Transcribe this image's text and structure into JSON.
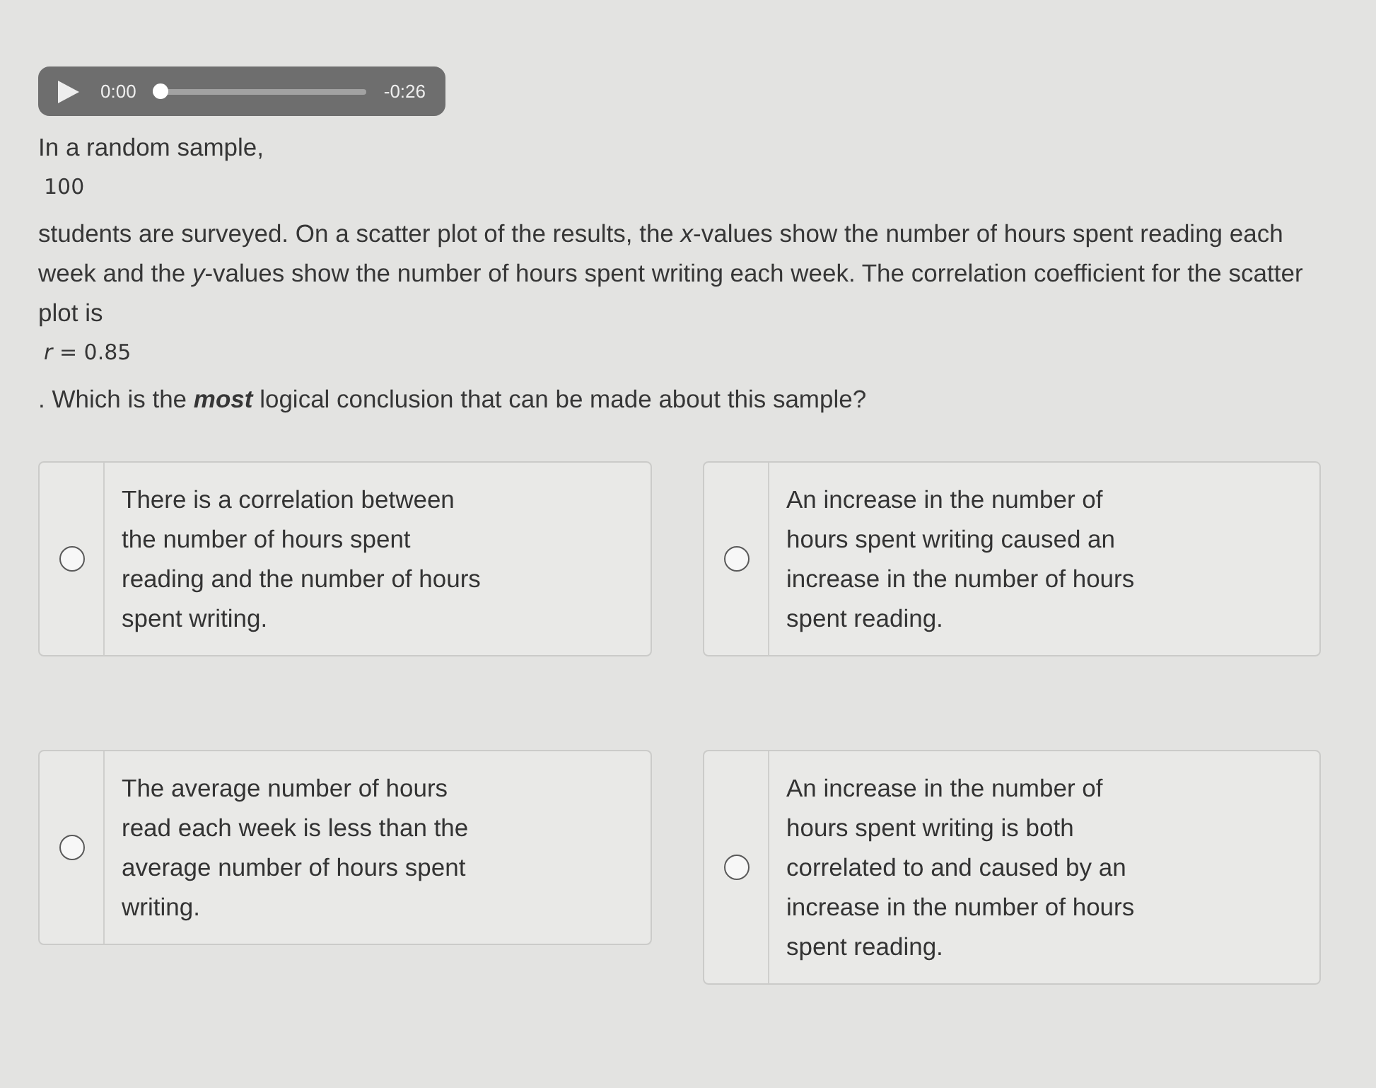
{
  "player": {
    "playing": false,
    "elapsed": "0:00",
    "remaining": "-0:26",
    "level": 0
  },
  "question": [
    {
      "kind": "text",
      "text": "In a random sample,"
    },
    {
      "kind": "math",
      "text": "100"
    },
    {
      "kind": "text",
      "text": "students are surveyed. On a scatter plot of the results, the *x*-values show the number of hours spent reading each week and the *y*-values show the number of hours spent writing each week. The correlation coefficient for the scatter plot is"
    },
    {
      "kind": "math",
      "text": "*r* = 0.85"
    },
    {
      "kind": "text",
      "text": ". Which is the **most** logical conclusion that can be made about this sample?"
    }
  ],
  "choices": [
    {
      "text": "There is a correlation between the number of hours spent reading and the number of hours spent writing.",
      "selected": false
    },
    {
      "text": "An increase in the number of hours spent writing caused an increase in the number of hours spent reading.",
      "selected": false
    },
    {
      "text": "The average number of hours read each week is less than the average number of hours spent writing.",
      "selected": false
    },
    {
      "text": "An increase in the number of hours spent writing is both correlated to and caused by an increase in the number of hours spent reading.",
      "selected": false
    }
  ]
}
